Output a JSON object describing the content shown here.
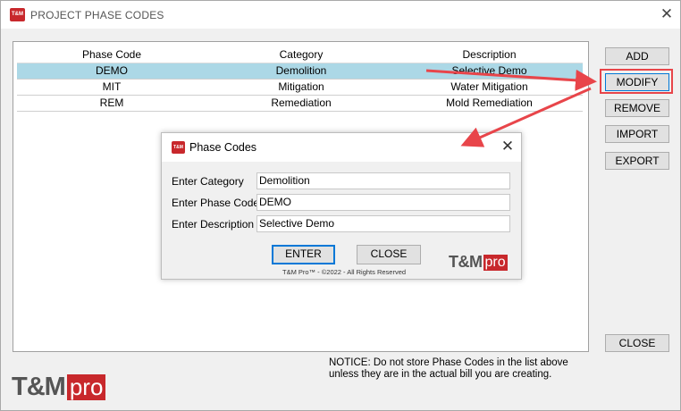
{
  "window": {
    "icon_text": "T&M",
    "title": "PROJECT PHASE CODES",
    "close_glyph": "✕"
  },
  "table": {
    "headers": [
      "Phase Code",
      "Category",
      "Description"
    ],
    "rows": [
      {
        "code": "DEMO",
        "category": "Demolition",
        "description": "Selective Demo",
        "selected": true
      },
      {
        "code": "MIT",
        "category": "Mitigation",
        "description": "Water Mitigation",
        "selected": false
      },
      {
        "code": "REM",
        "category": "Remediation",
        "description": "Mold Remediation",
        "selected": false
      }
    ]
  },
  "buttons": {
    "add": "ADD",
    "modify": "MODIFY",
    "remove": "REMOVE",
    "import": "IMPORT",
    "export": "EXPORT",
    "close": "CLOSE"
  },
  "notice": "NOTICE:  Do not store Phase Codes in the list above unless they are in the actual bill you are creating.",
  "logo": {
    "main": "T&M",
    "accent": "pro"
  },
  "dialog": {
    "icon_text": "T&M",
    "title": "Phase Codes",
    "close_glyph": "✕",
    "fields": {
      "category": {
        "label": "Enter Category",
        "value": "Demolition"
      },
      "phase_code": {
        "label": "Enter Phase Code",
        "value": "DEMO"
      },
      "description": {
        "label": "Enter Description",
        "value": "Selective Demo"
      }
    },
    "enter_label": "ENTER",
    "close_label": "CLOSE",
    "copyright": "T&M Pro™ - ©2022 - All Rights Reserved",
    "logo": {
      "main": "T&M",
      "accent": "pro"
    }
  },
  "colors": {
    "brand_red": "#c8282c",
    "selection_blue": "#acd8e6",
    "annotation_red": "#e8454a"
  }
}
